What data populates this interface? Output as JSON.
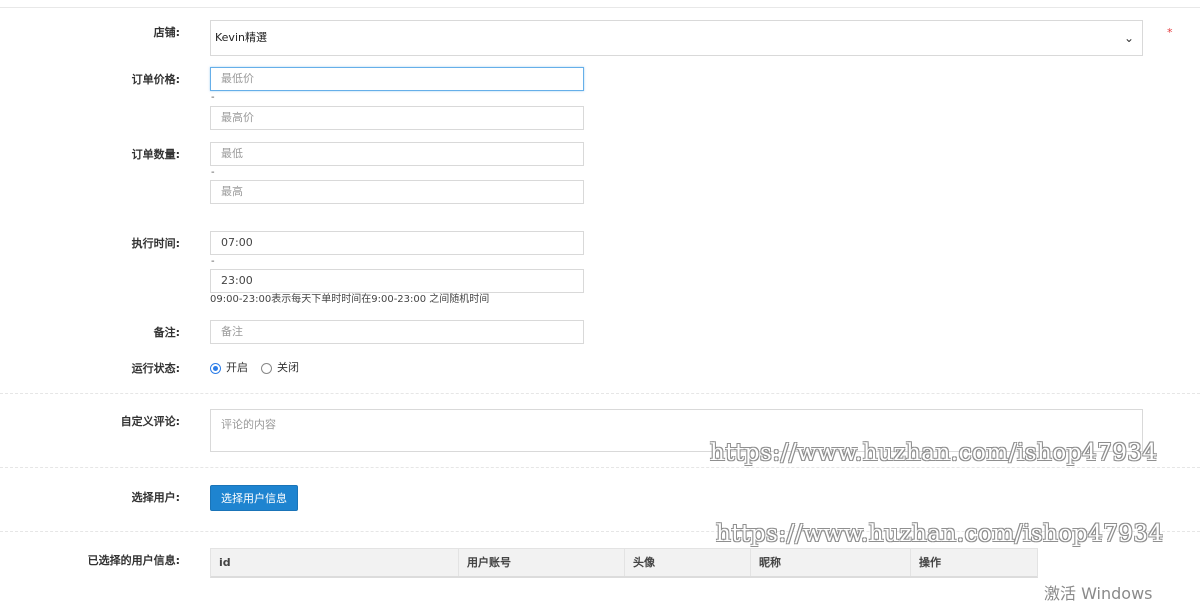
{
  "form": {
    "shop": {
      "label": "店铺:",
      "value": "Kevin精選",
      "required_mark": "*"
    },
    "order_price": {
      "label": "订单价格:",
      "min_placeholder": "最低价",
      "separator": "-",
      "max_placeholder": "最高价"
    },
    "order_count": {
      "label": "订单数量:",
      "min_placeholder": "最低",
      "separator": "-",
      "max_placeholder": "最高"
    },
    "exec_time": {
      "label": "执行时间:",
      "start_value": "07:00",
      "separator": "-",
      "end_value": "23:00",
      "hint": "09:00-23:00表示每天下单时时间在9:00-23:00 之间随机时间"
    },
    "remark": {
      "label": "备注:",
      "placeholder": "备注"
    },
    "run_status": {
      "label": "运行状态:",
      "options": [
        "开启",
        "关闭"
      ],
      "selected": "开启"
    },
    "custom_comment": {
      "label": "自定义评论:",
      "placeholder": "评论的内容"
    },
    "select_user": {
      "label": "选择用户:",
      "button": "选择用户信息"
    },
    "selected_users": {
      "label": "已选择的用户信息:",
      "columns": [
        "id",
        "用户账号",
        "头像",
        "昵称",
        "操作"
      ]
    }
  },
  "watermarks": [
    "https://www.huzhan.com/ishop47934",
    "https://www.huzhan.com/ishop47934"
  ],
  "os_overlay": "激活 Windows",
  "colors": {
    "accent": "#1e84d0",
    "required": "#e4393c",
    "focus": "#66afe9"
  }
}
